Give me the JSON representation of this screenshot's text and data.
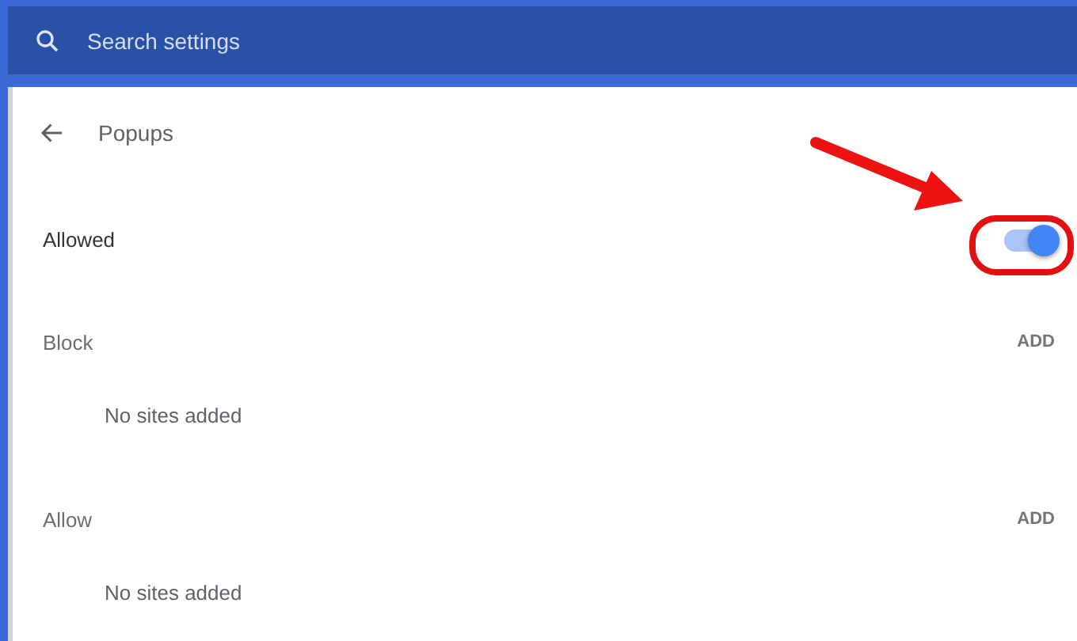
{
  "search": {
    "placeholder": "Search settings"
  },
  "page": {
    "title": "Popups"
  },
  "setting": {
    "label": "Allowed",
    "on": true
  },
  "sections": [
    {
      "title": "Block",
      "action": "ADD",
      "empty_text": "No sites added"
    },
    {
      "title": "Allow",
      "action": "ADD",
      "empty_text": "No sites added"
    }
  ]
}
